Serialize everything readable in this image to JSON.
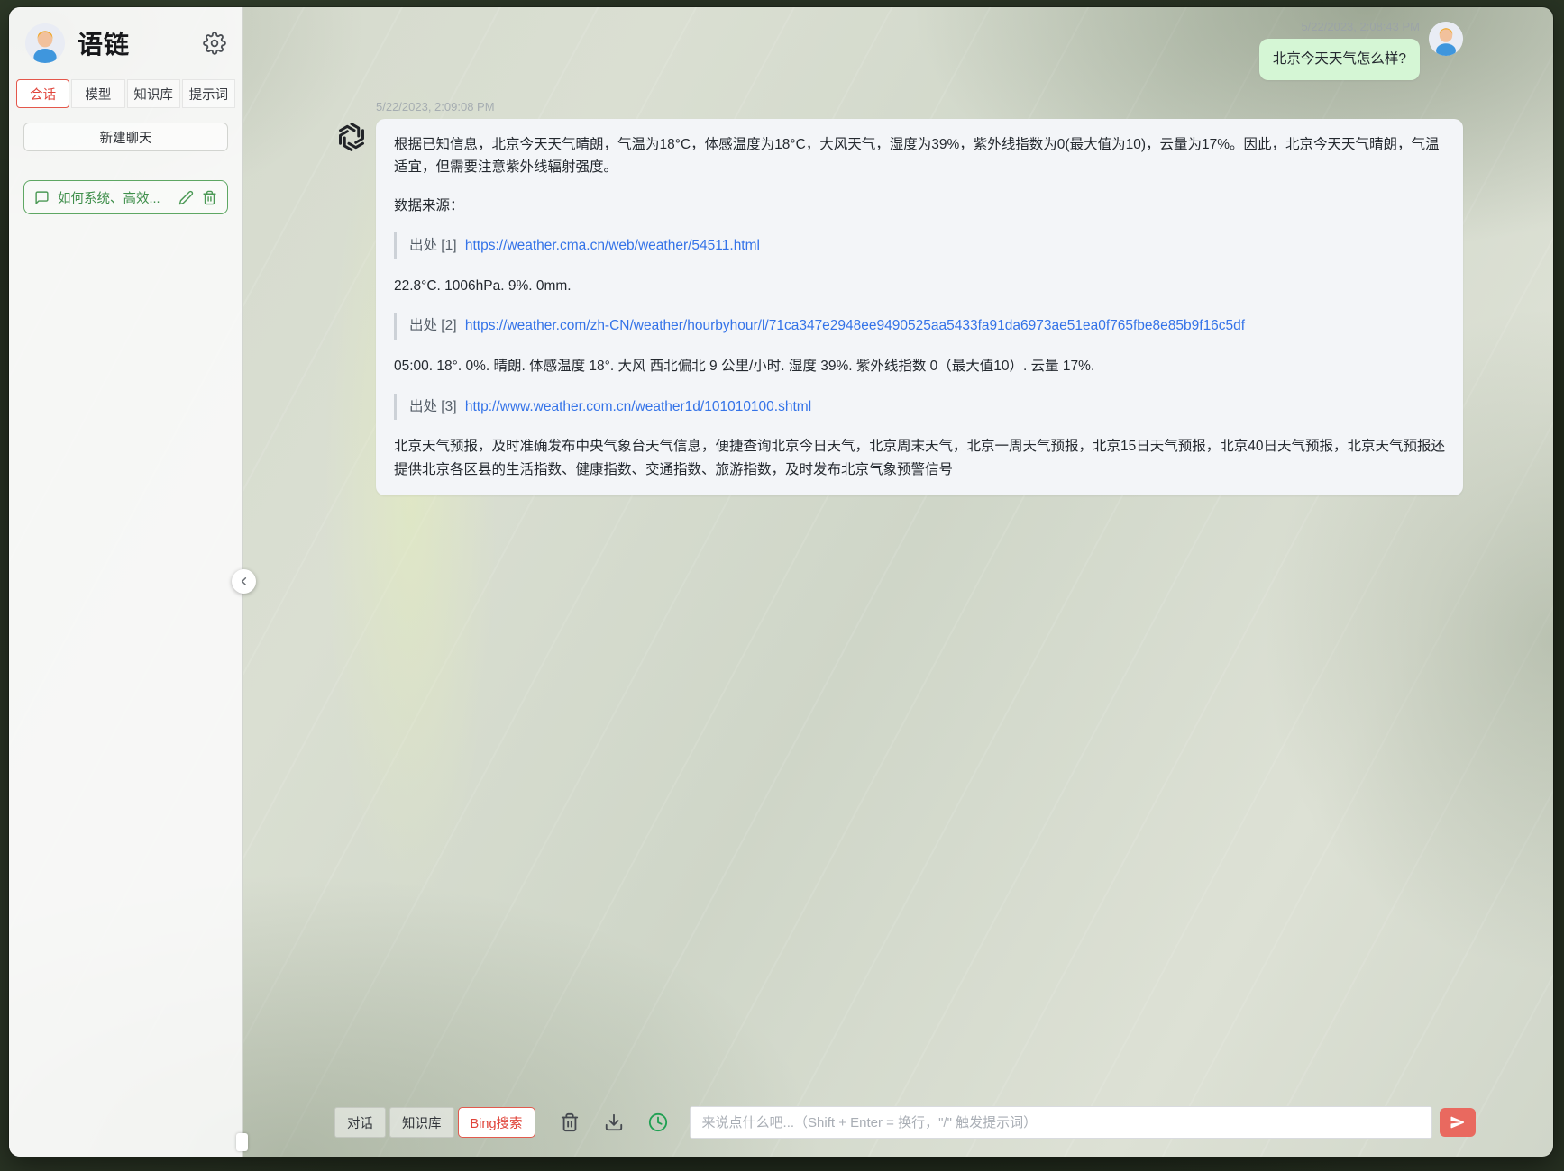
{
  "sidebar": {
    "title": "语链",
    "tabs": [
      {
        "label": "会话",
        "active": true
      },
      {
        "label": "模型",
        "active": false
      },
      {
        "label": "知识库",
        "active": false
      },
      {
        "label": "提示词",
        "active": false
      }
    ],
    "new_chat_label": "新建聊天",
    "chat_items": [
      {
        "title": "如何系统、高效..."
      }
    ]
  },
  "chat": {
    "user": {
      "timestamp": "5/22/2023, 2:08:43 PM",
      "text": "北京今天天气怎么样?"
    },
    "assistant": {
      "timestamp": "5/22/2023, 2:09:08 PM",
      "intro": "根据已知信息，北京今天天气晴朗，气温为18°C，体感温度为18°C，大风天气，湿度为39%，紫外线指数为0(最大值为10)，云量为17%。因此，北京今天天气晴朗，气温适宜，但需要注意紫外线辐射强度。",
      "sources_label": "数据来源：",
      "citation1_prefix": "出处 [1]",
      "citation1_url": "https://weather.cma.cn/web/weather/54511.html",
      "snippet1": "22.8°C. 1006hPa. 9%. 0mm.",
      "citation2_prefix": "出处 [2]",
      "citation2_url": "https://weather.com/zh-CN/weather/hourbyhour/l/71ca347e2948ee9490525aa5433fa91da6973ae51ea0f765fbe8e85b9f16c5df",
      "snippet2": "05:00. 18°. 0%. 晴朗. 体感温度 18°. 大风 西北偏北 9 公里/小时. 湿度 39%. 紫外线指数 0（最大值10）. 云量 17%.",
      "citation3_prefix": "出处 [3]",
      "citation3_url": "http://www.weather.com.cn/weather1d/101010100.shtml",
      "outro": "北京天气预报，及时准确发布中央气象台天气信息，便捷查询北京今日天气，北京周末天气，北京一周天气预报，北京15日天气预报，北京40日天气预报，北京天气预报还提供北京各区县的生活指数、健康指数、交通指数、旅游指数，及时发布北京气象预警信号"
    }
  },
  "composer": {
    "mode_buttons": [
      {
        "label": "对话",
        "active": false
      },
      {
        "label": "知识库",
        "active": false
      },
      {
        "label": "Bing搜索",
        "active": true
      }
    ],
    "placeholder": "来说点什么吧...（Shift + Enter = 换行，\"/\" 触发提示词）",
    "input_value": ""
  },
  "colors": {
    "accent_red": "#e4574b",
    "bing_red": "#e0443a",
    "item_green": "#5ea763",
    "link_blue": "#3473e8",
    "user_bubble": "#d5f6d5",
    "bot_bubble": "#f3f5f8",
    "send_button": "#e9695f",
    "clock_green": "#1fa052"
  }
}
